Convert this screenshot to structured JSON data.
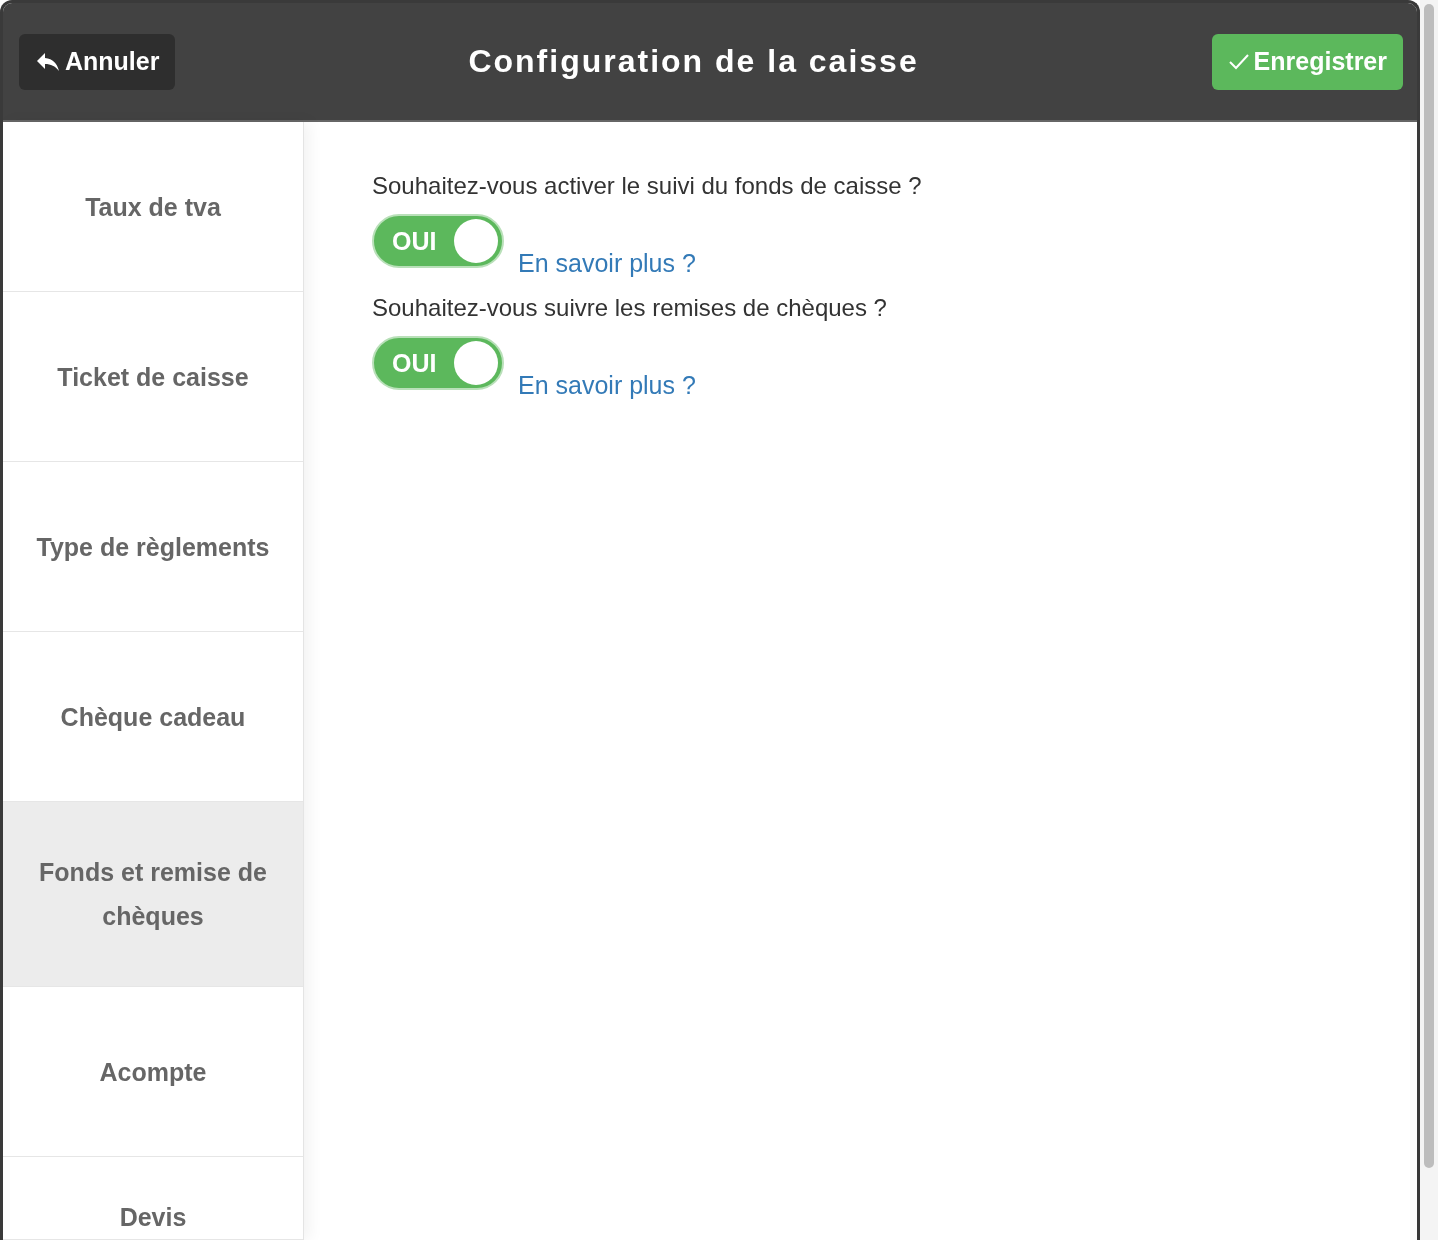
{
  "header": {
    "cancel_button": "Annuler",
    "title": "Configuration de la caisse",
    "save_button": "Enregistrer"
  },
  "sidebar": {
    "items": [
      {
        "label": "Taux de tva",
        "selected": false
      },
      {
        "label": "Ticket de caisse",
        "selected": false
      },
      {
        "label": "Type de règlements",
        "selected": false
      },
      {
        "label": "Chèque cadeau",
        "selected": false
      },
      {
        "label": "Fonds et remise de chèques",
        "selected": true
      },
      {
        "label": "Acompte",
        "selected": false
      },
      {
        "label": "Devis",
        "selected": false
      }
    ]
  },
  "settings": [
    {
      "question": "Souhaitez-vous activer le suivi du fonds de caisse ?",
      "toggle_label": "OUI",
      "on": true,
      "link": "En savoir plus ?"
    },
    {
      "question": "Souhaitez-vous suivre les remises de chèques ?",
      "toggle_label": "OUI",
      "on": true,
      "link": "En savoir plus ?"
    }
  ]
}
